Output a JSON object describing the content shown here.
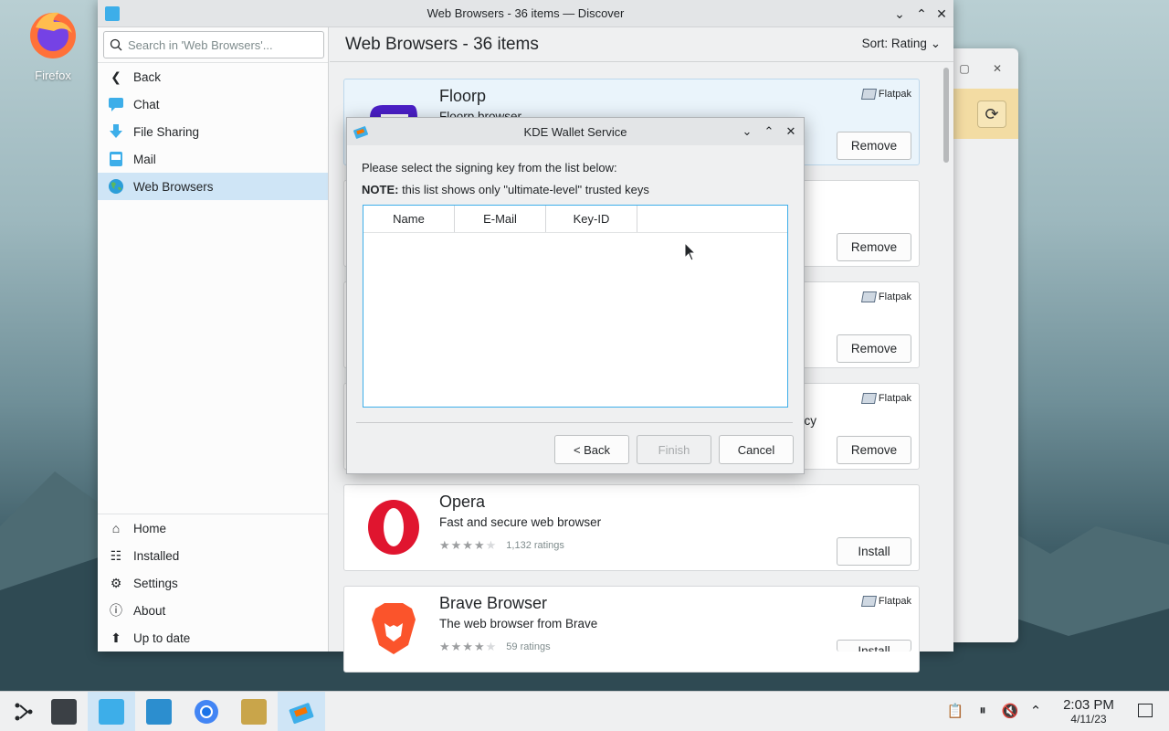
{
  "desktop": {
    "icon_label": "Firefox"
  },
  "main_window": {
    "title": "Web Browsers - 36 items — Discover",
    "search_placeholder": "Search in 'Web Browsers'...",
    "nav_items": [
      {
        "label": "Back",
        "icon": "back-arrow-icon"
      },
      {
        "label": "Chat",
        "icon": "chat-icon"
      },
      {
        "label": "File Sharing",
        "icon": "file-sharing-icon"
      },
      {
        "label": "Mail",
        "icon": "mail-icon"
      },
      {
        "label": "Web Browsers",
        "icon": "globe-icon",
        "active": true
      }
    ],
    "nav_bottom": [
      {
        "label": "Home",
        "icon": "home-icon"
      },
      {
        "label": "Installed",
        "icon": "installed-icon"
      },
      {
        "label": "Settings",
        "icon": "settings-icon"
      },
      {
        "label": "About",
        "icon": "info-icon"
      },
      {
        "label": "Up to date",
        "icon": "update-icon"
      }
    ],
    "page_title": "Web Browsers - 36 items",
    "sort_label": "Sort: Rating",
    "apps": [
      {
        "name": "Floorp",
        "description": "Floorp browser",
        "source": "Flatpak",
        "action": "Remove"
      },
      {
        "name": "",
        "description": "",
        "source": "",
        "action": "Remove"
      },
      {
        "name": "",
        "description": "",
        "source": "Flatpak",
        "action": "Remove"
      },
      {
        "name": "",
        "description": "ncy",
        "source": "Flatpak",
        "action": "Remove"
      },
      {
        "name": "Opera",
        "description": "Fast and secure web browser",
        "ratings": "1,132 ratings",
        "stars": 4,
        "source": "",
        "action": "Install"
      },
      {
        "name": "Brave Browser",
        "description": "The web browser from Brave",
        "ratings": "59 ratings",
        "stars": 4,
        "source": "Flatpak",
        "action": "Install"
      }
    ]
  },
  "dialog": {
    "title": "KDE Wallet Service",
    "message": "Please select the signing key from the list below:",
    "note_label": "NOTE:",
    "note_text": " this list shows only \"ultimate-level\" trusted keys",
    "columns": [
      "Name",
      "E-Mail",
      "Key-ID"
    ],
    "buttons": {
      "back": "< Back",
      "finish": "Finish",
      "cancel": "Cancel"
    }
  },
  "taskbar": {
    "time": "2:03 PM",
    "date": "4/11/23"
  },
  "colors": {
    "accent": "#3daee9",
    "selection": "#cfe5f6",
    "window_bg": "#eff0f1"
  }
}
